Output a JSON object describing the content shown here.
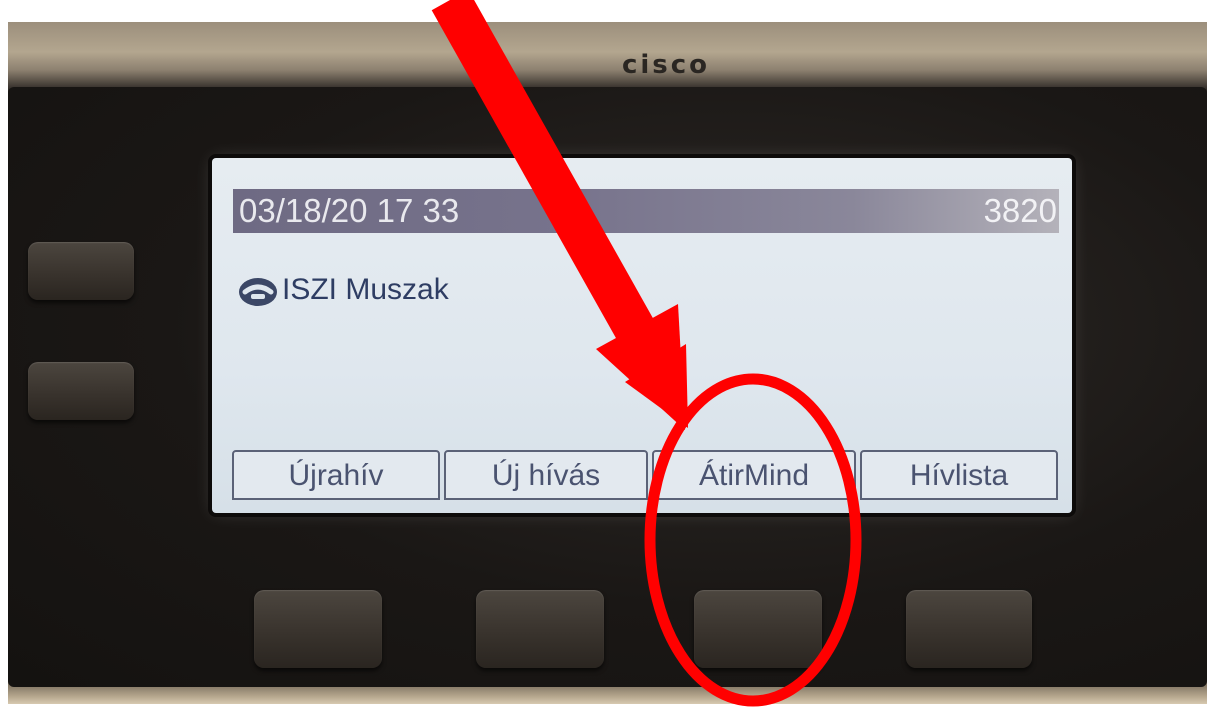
{
  "device": {
    "brand": "cisco"
  },
  "screen": {
    "status_bar": {
      "datetime": "03/18/20 17 33",
      "extension": "3820"
    },
    "line": {
      "icon": "handset-icon",
      "label": "ISZI Muszak"
    },
    "softkeys": [
      {
        "label": "Újrahív"
      },
      {
        "label": "Új hívás"
      },
      {
        "label": "ÁtirMind"
      },
      {
        "label": "Hívlista"
      }
    ]
  },
  "annotation": {
    "color": "#ff0000",
    "highlight": "ÁtirMind"
  }
}
